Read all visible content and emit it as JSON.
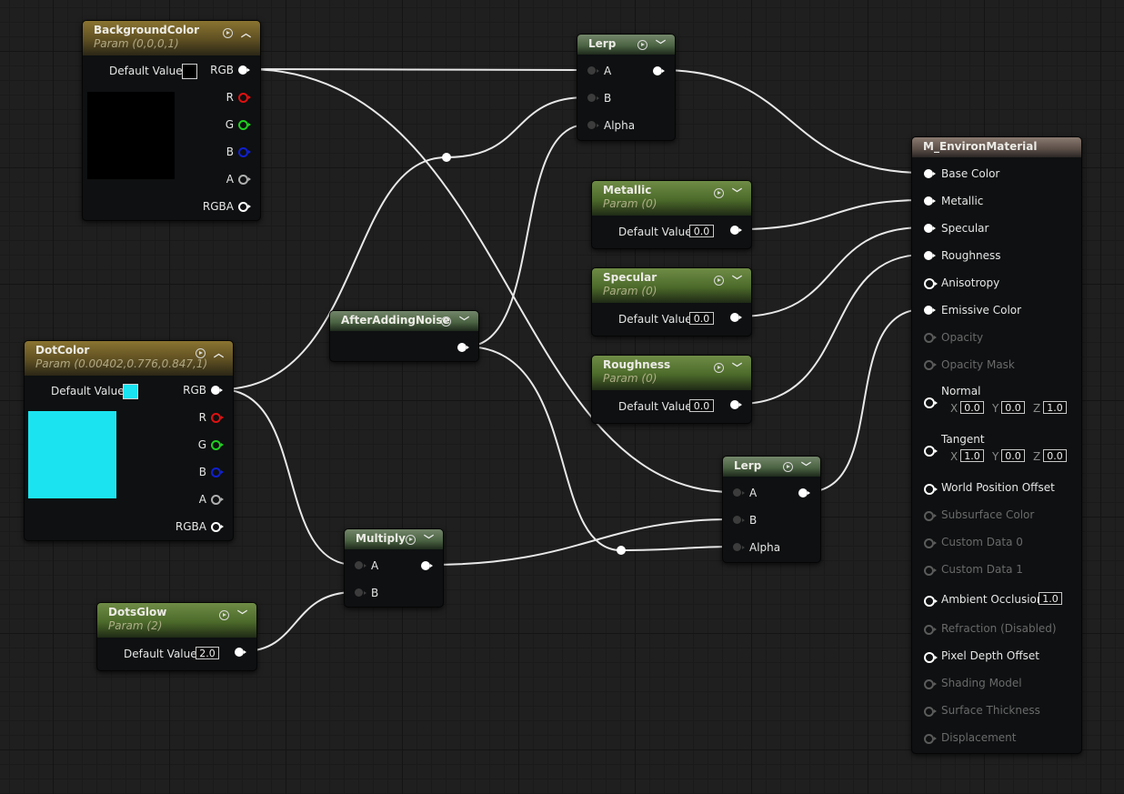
{
  "colors": {
    "wire": "#e8e8e8",
    "vector_param_header": "#8a7431",
    "scalar_param_header": "#6f8c46",
    "op_header": "#73866a",
    "material_header": "#8a7a70",
    "pin_r": "#e01010",
    "pin_g": "#20d020",
    "pin_b": "#1020d0",
    "pin_a": "#b0b0b0",
    "background_color_value": "#000000",
    "dot_color_value": "#1be4f0"
  },
  "icons": {
    "preview": "play-circle-icon",
    "collapse": "chevron-up-icon",
    "expand": "chevron-down-icon"
  },
  "background_color": {
    "title": "BackgroundColor",
    "subtitle": "Param (0,0,0,1)",
    "default_label": "Default Value",
    "outputs": [
      "RGB",
      "R",
      "G",
      "B",
      "A",
      "RGBA"
    ]
  },
  "dot_color": {
    "title": "DotColor",
    "subtitle": "Param (0.00402,0.776,0.847,1)",
    "default_label": "Default Value",
    "outputs": [
      "RGB",
      "R",
      "G",
      "B",
      "A",
      "RGBA"
    ]
  },
  "dots_glow": {
    "title": "DotsGlow",
    "subtitle": "Param (2)",
    "default_label": "Default Value",
    "value": "2.0"
  },
  "after_adding_noise": {
    "title": "AfterAddingNoise"
  },
  "multiply": {
    "title": "Multiply",
    "inputs": [
      "A",
      "B"
    ]
  },
  "lerp_top": {
    "title": "Lerp",
    "inputs": [
      "A",
      "B",
      "Alpha"
    ]
  },
  "lerp_bottom": {
    "title": "Lerp",
    "inputs": [
      "A",
      "B",
      "Alpha"
    ]
  },
  "metallic": {
    "title": "Metallic",
    "subtitle": "Param (0)",
    "default_label": "Default Value",
    "value": "0.0"
  },
  "specular": {
    "title": "Specular",
    "subtitle": "Param (0)",
    "default_label": "Default Value",
    "value": "0.0"
  },
  "roughness": {
    "title": "Roughness",
    "subtitle": "Param (0)",
    "default_label": "Default Value",
    "value": "0.0"
  },
  "material": {
    "title": "M_EnvironMaterial",
    "pins": {
      "base_color": "Base Color",
      "metallic": "Metallic",
      "specular": "Specular",
      "roughness": "Roughness",
      "anisotropy": "Anisotropy",
      "emissive": "Emissive Color",
      "opacity": "Opacity",
      "opacity_mask": "Opacity Mask",
      "normal": "Normal",
      "tangent": "Tangent",
      "wpo": "World Position Offset",
      "subsurface": "Subsurface Color",
      "custom0": "Custom Data 0",
      "custom1": "Custom Data 1",
      "ao": "Ambient Occlusion",
      "refraction": "Refraction (Disabled)",
      "pdo": "Pixel Depth Offset",
      "shading_model": "Shading Model",
      "surface_thickness": "Surface Thickness",
      "displacement": "Displacement"
    },
    "normal_vals": {
      "x_label": "X",
      "x": "0.0",
      "y_label": "Y",
      "y": "0.0",
      "z_label": "Z",
      "z": "1.0"
    },
    "tangent_vals": {
      "x_label": "X",
      "x": "1.0",
      "y_label": "Y",
      "y": "0.0",
      "z_label": "Z",
      "z": "0.0"
    },
    "ao_value": "1.0"
  }
}
